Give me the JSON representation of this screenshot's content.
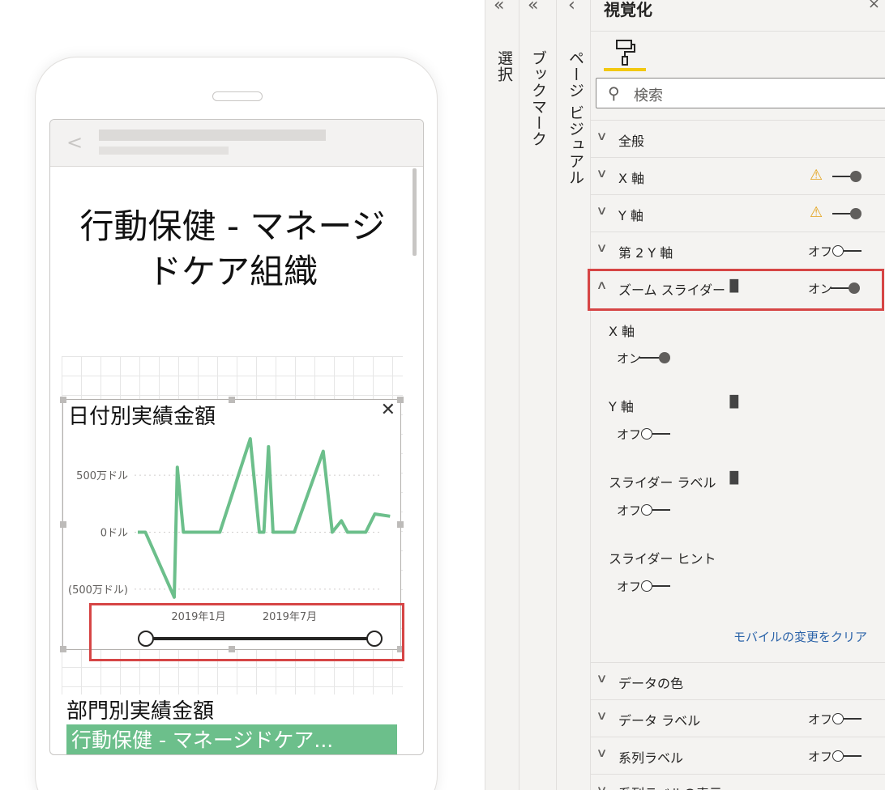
{
  "report": {
    "title": "行動保健 - マネージドケア組織",
    "line_chart_title": "日付別実績金額",
    "bar_chart_title": "部門別実績金額",
    "bar_item_label": "行動保健 - マネージドケア..."
  },
  "chart_data": {
    "type": "line",
    "title": "日付別実績金額",
    "y_tick_labels": [
      "500万ドル",
      "0ドル",
      "(500万ドル)"
    ],
    "y_ticks": [
      5000000,
      0,
      -5000000
    ],
    "x_tick_labels": [
      "2019年1月",
      "2019年7月"
    ],
    "x": [
      "2018-09",
      "2018-10",
      "2018-11",
      "2018-12",
      "2019-01",
      "2019-02",
      "2019-03",
      "2019-04",
      "2019-05",
      "2019-06",
      "2019-07",
      "2019-08",
      "2019-09",
      "2019-10",
      "2019-11",
      "2019-12"
    ],
    "series": [
      {
        "color": "#6cbf8b",
        "points": [
          [
            0,
            0
          ],
          [
            0.5,
            0
          ],
          [
            2.4,
            -5700000
          ],
          [
            2.6,
            5700000
          ],
          [
            3.0,
            0
          ],
          [
            4.2,
            0
          ],
          [
            5.4,
            0
          ],
          [
            7.4,
            8200000
          ],
          [
            8.0,
            0
          ],
          [
            8.3,
            0
          ],
          [
            8.6,
            7500000
          ],
          [
            8.9,
            0
          ],
          [
            10.3,
            0
          ],
          [
            12.2,
            7100000
          ],
          [
            12.8,
            0
          ],
          [
            13.4,
            1000000
          ],
          [
            13.8,
            0
          ],
          [
            14.4,
            0
          ],
          [
            15.0,
            0
          ],
          [
            15.6,
            1600000
          ],
          [
            16.6,
            1400000
          ]
        ]
      }
    ],
    "ylim": [
      -6000000,
      8200000
    ]
  },
  "panes": {
    "selection": "選択",
    "bookmarks": "ブックマーク",
    "page_visual": "ページ ビジュアル",
    "collapse_glyph": "«",
    "back_glyph": "‹"
  },
  "viz": {
    "title": "視覚化",
    "close_glyph": "×",
    "search_placeholder": "検索",
    "reset_link": "モバイルの変更をクリア",
    "sections": [
      {
        "label": "全般"
      },
      {
        "label": "X 軸",
        "warning": "⚠"
      },
      {
        "label": "Y 軸",
        "warning": "⚠"
      },
      {
        "label": "第 2 Y 軸",
        "state": "オフ"
      },
      {
        "label": "ズーム スライダー",
        "state": "オン"
      },
      {
        "label": "データの色"
      },
      {
        "label": "データ ラベル",
        "state": "オフ"
      },
      {
        "label": "系列ラベル",
        "state": "オフ"
      }
    ],
    "zoom_options": [
      {
        "label": "X 軸",
        "state": "オン"
      },
      {
        "label": "Y 軸",
        "state": "オフ"
      },
      {
        "label": "スライダー ラベル",
        "state": "オフ"
      },
      {
        "label": "スライダー ヒント",
        "state": "オフ"
      }
    ],
    "bottom_partial_label": "系列ラベルの表示"
  },
  "colors": {
    "accent_yellow": "#f2c811",
    "highlight_red": "#d64545",
    "series_green": "#6cbf8b",
    "link_blue": "#2b63a9"
  }
}
